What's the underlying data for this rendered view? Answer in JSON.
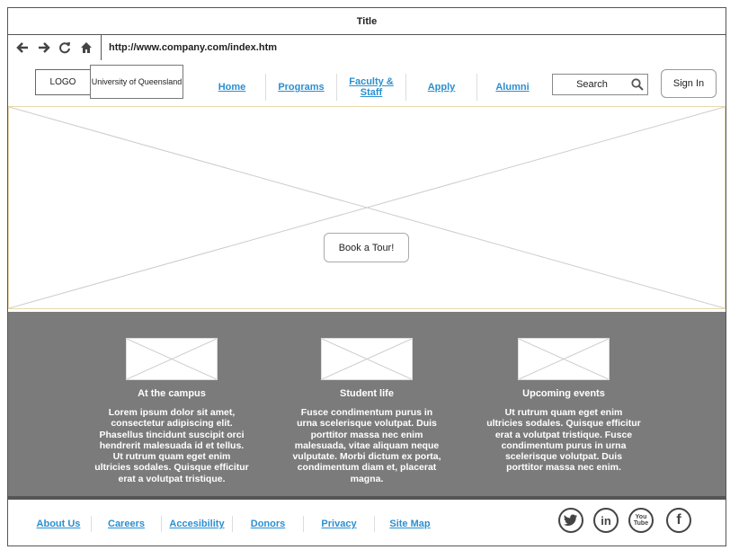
{
  "window": {
    "title": "Title"
  },
  "address_bar": {
    "url": "http://www.company.com/index.htm"
  },
  "header": {
    "logo": "LOGO",
    "university": "University of Queensland",
    "nav": [
      {
        "label": "Home"
      },
      {
        "label": "Programs"
      },
      {
        "label": "Faculty & Staff"
      },
      {
        "label": "Apply"
      },
      {
        "label": "Alumni"
      }
    ],
    "search_label": "Search",
    "signin_label": "Sign In"
  },
  "hero": {
    "button_label": "Book a Tour!"
  },
  "features": [
    {
      "title": "At the campus",
      "text": "Lorem ipsum dolor sit amet, consectetur adipiscing elit. Phasellus tincidunt suscipit orci hendrerit malesuada id et tellus. Ut rutrum quam eget enim ultricies sodales. Quisque efficitur erat a volutpat tristique."
    },
    {
      "title": "Student life",
      "text": "Fusce condimentum purus in urna scelerisque volutpat. Duis porttitor massa nec enim malesuada, vitae aliquam neque vulputate. Morbi dictum ex porta, condimentum diam et, placerat magna."
    },
    {
      "title": "Upcoming events",
      "text": "Ut rutrum quam eget enim ultricies sodales. Quisque efficitur erat a volutpat tristique. Fusce condimentum purus in urna scelerisque volutpat. Duis porttitor massa nec enim."
    }
  ],
  "footer": {
    "links": [
      {
        "label": "About Us"
      },
      {
        "label": "Careers"
      },
      {
        "label": "Accesibility"
      },
      {
        "label": "Donors"
      },
      {
        "label": "Privacy"
      },
      {
        "label": "Site Map"
      }
    ],
    "social": [
      {
        "icon": "twitter-icon"
      },
      {
        "icon": "linkedin-icon",
        "glyph": "in"
      },
      {
        "icon": "youtube-icon",
        "glyph": "You Tube"
      },
      {
        "icon": "facebook-icon",
        "glyph": "f"
      }
    ]
  },
  "colors": {
    "link": "#2a8fd0",
    "features_bg": "#7b7b7b"
  }
}
